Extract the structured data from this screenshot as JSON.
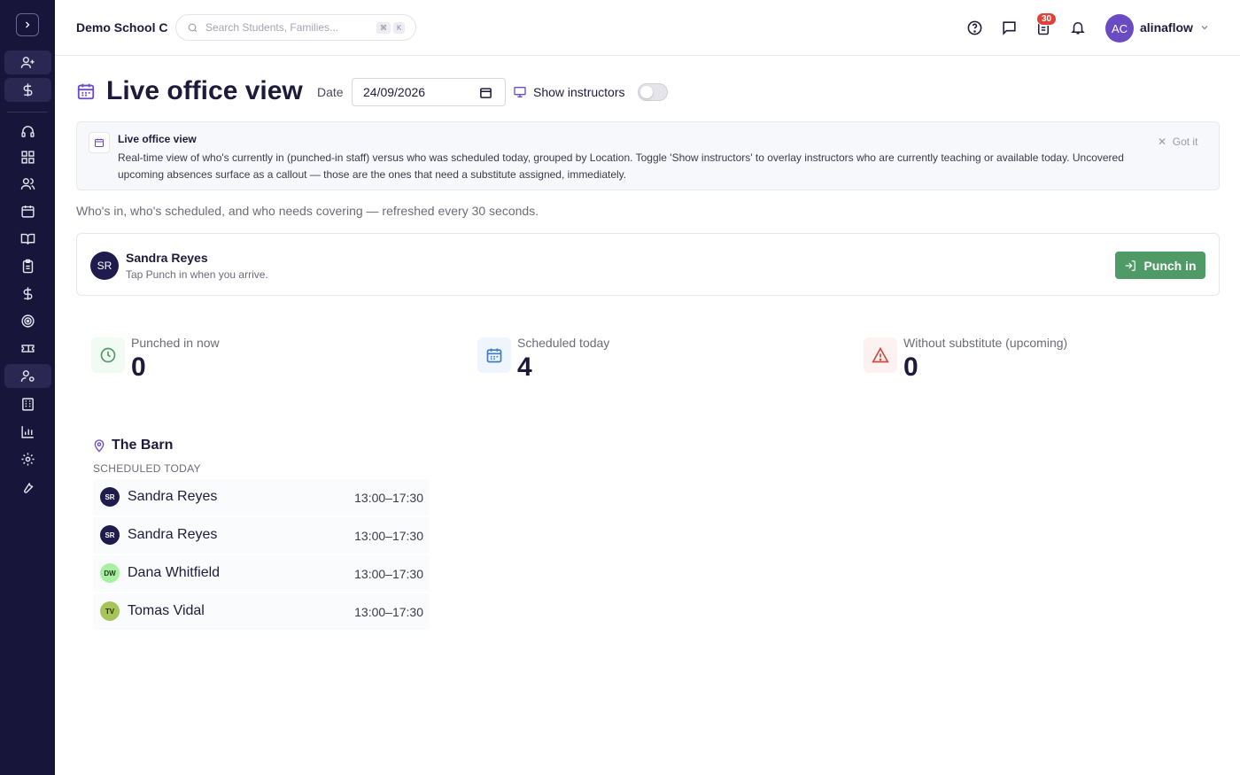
{
  "header": {
    "school": "Demo School C",
    "search_placeholder": "Search Students, Families...",
    "kbd1": "⌘",
    "kbd2": "K",
    "tasks_badge": "30",
    "user_initials": "AC",
    "username": "alinaflow"
  },
  "page": {
    "title": "Live office view",
    "date_label": "Date",
    "date_value": "24/09/2026",
    "show_instructors_label": "Show instructors",
    "show_instructors_on": false
  },
  "info": {
    "title": "Live office view",
    "body": "Real-time view of who's currently in (punched-in staff) versus who was scheduled today, grouped by Location. Toggle 'Show instructors' to overlay instructors who are currently teaching or available today. Uncovered upcoming absences surface as a callout — those are the ones that need a substitute assigned, immediately.",
    "dismiss": "Got it"
  },
  "subtitle": "Who's in, who's scheduled, and who needs covering — refreshed every 30 seconds.",
  "punch": {
    "initials": "SR",
    "name": "Sandra Reyes",
    "hint": "Tap Punch in when you arrive.",
    "button": "Punch in"
  },
  "stats": [
    {
      "label": "Punched in now",
      "value": "0"
    },
    {
      "label": "Scheduled today",
      "value": "4"
    },
    {
      "label": "Without substitute (upcoming)",
      "value": "0"
    }
  ],
  "location": {
    "name": "The Barn",
    "section_label": "SCHEDULED TODAY",
    "rows": [
      {
        "initials": "SR",
        "name": "Sandra Reyes",
        "time": "13:00–17:30",
        "color": "#1f1b4d",
        "text_color": "#ffffff"
      },
      {
        "initials": "SR",
        "name": "Sandra Reyes",
        "time": "13:00–17:30",
        "color": "#1f1b4d",
        "text_color": "#ffffff"
      },
      {
        "initials": "DW",
        "name": "Dana Whitfield",
        "time": "13:00–17:30",
        "color": "#a7f0a0",
        "text_color": "#1e3a1e"
      },
      {
        "initials": "TV",
        "name": "Tomas Vidal",
        "time": "13:00–17:30",
        "color": "#a6c45a",
        "text_color": "#1e2a10"
      }
    ]
  },
  "colors": {
    "sidebar_bg": "#17153a",
    "accent": "#6a4bc4",
    "punch_button": "#4f9a67",
    "badge": "#e0413a"
  }
}
